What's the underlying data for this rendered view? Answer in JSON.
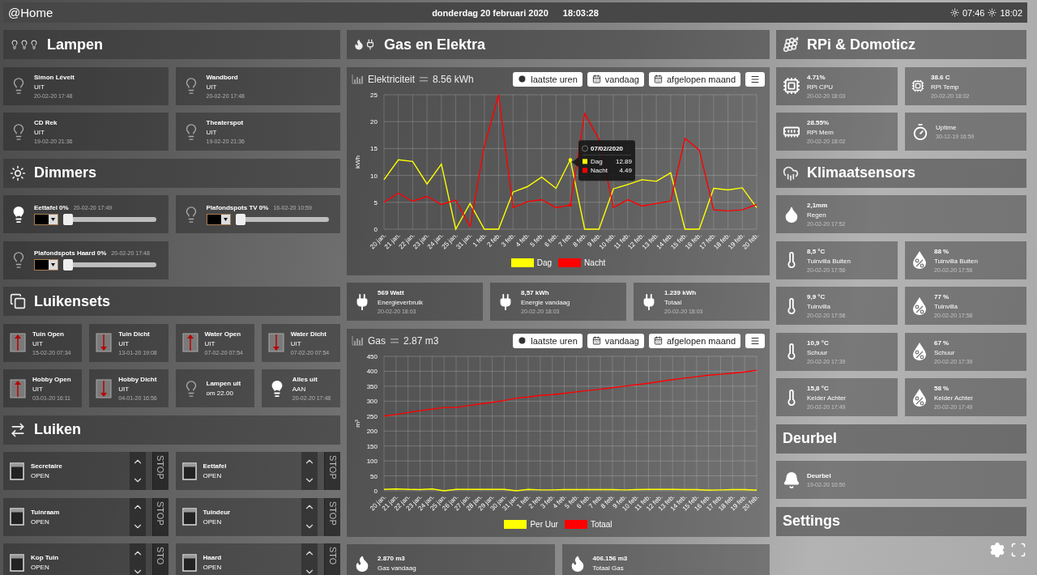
{
  "topbar": {
    "title": "@Home",
    "date": "donderdag 20 februari 2020",
    "time": "18:03:28",
    "sunrise": "07:46",
    "sunset": "18:02"
  },
  "columns": [
    [
      {
        "kind": "lamps",
        "title": "Lampen",
        "items": [
          {
            "kind": "lamp",
            "on": false,
            "title": "Simon Lévelt",
            "status": "UIT",
            "date": "20-02-20 17:48"
          },
          {
            "kind": "lamp",
            "on": false,
            "title": "Wandbord",
            "status": "UIT",
            "date": "20-02-20 17:48"
          },
          {
            "kind": "lamp",
            "on": false,
            "title": "CD Rek",
            "status": "UIT",
            "date": "19-02-20 21:36"
          },
          {
            "kind": "lamp",
            "on": false,
            "title": "Theaterspot",
            "status": "UIT",
            "date": "19-02-20 21:36"
          }
        ]
      },
      {
        "kind": "dimmers",
        "title": "Dimmers",
        "items": [
          {
            "kind": "dimmer",
            "on": true,
            "title": "Eettafel 0%",
            "date": "20-02-20 17:49",
            "color": "#000000",
            "level": 0
          },
          {
            "kind": "dimmer",
            "on": false,
            "title": "Plafondspots TV 0%",
            "date": "16-02-20 10:59",
            "color": "#000000",
            "level": 0
          },
          {
            "kind": "dimmer",
            "on": false,
            "title": "Plafondspots Haard 0%",
            "date": "20-02-20 17:48",
            "color": "#000000",
            "level": 0
          }
        ]
      },
      {
        "kind": "scenes",
        "title": "Luikensets",
        "items": [
          {
            "kind": "open",
            "title": "Tuin Open",
            "status": "UIT",
            "date": "15-02-20 07:34"
          },
          {
            "kind": "close",
            "title": "Tuin Dicht",
            "status": "UIT",
            "date": "13-01-20 19:08"
          },
          {
            "kind": "open",
            "title": "Water Open",
            "status": "UIT",
            "date": "07-02-20 07:54"
          },
          {
            "kind": "close",
            "title": "Water Dicht",
            "status": "UIT",
            "date": "07-02-20 07:54"
          },
          {
            "kind": "open",
            "title": "Hobby Open",
            "status": "UIT",
            "date": "03-01-20 16:11"
          },
          {
            "kind": "close",
            "title": "Hobby Dicht",
            "status": "UIT",
            "date": "04-01-20 16:56"
          },
          {
            "kind": "lamp",
            "on": false,
            "title": "Lampen uit",
            "status": "om 22.00"
          },
          {
            "kind": "lamp",
            "on": true,
            "title": "Alles uit",
            "status": "AAN",
            "date": "20-02-20 17:48"
          }
        ]
      },
      {
        "kind": "blinds",
        "title": "Luiken",
        "items": [
          {
            "kind": "blind",
            "title": "Secretaire",
            "status": "OPEN",
            "stop": "STOP"
          },
          {
            "kind": "blind",
            "title": "Eettafel",
            "status": "OPEN",
            "stop": "STOP"
          },
          {
            "kind": "blind",
            "title": "Tuinraam",
            "status": "OPEN",
            "stop": "STOP"
          },
          {
            "kind": "blind",
            "title": "Tuindeur",
            "status": "OPEN",
            "stop": "STOP"
          },
          {
            "kind": "blind",
            "title": "Kop Tuin",
            "status": "OPEN",
            "stop": "STO"
          },
          {
            "kind": "blind",
            "title": "Haard",
            "status": "OPEN",
            "stop": "STO"
          }
        ]
      }
    ],
    [
      {
        "kind": "energy",
        "title": "Gas en Elektra",
        "items": [
          {
            "kind": "chart",
            "title": "Elektriciteit",
            "reading": "8.56 kWh",
            "buttons": [
              "laatste uren",
              "vandaag",
              "afgelopen maand"
            ],
            "chart_data": {
              "type": "line",
              "ylabel": "kWh",
              "categories": [
                "20 jan.",
                "21 jan.",
                "22 jan.",
                "23 jan.",
                "24 jan.",
                "25 jan.",
                "31 jan.",
                "1 feb.",
                "2 feb.",
                "3 feb.",
                "4 feb.",
                "5 feb.",
                "6 feb.",
                "7 feb.",
                "8 feb.",
                "9 feb.",
                "10 feb.",
                "11 feb.",
                "12 feb.",
                "13 feb.",
                "14 feb.",
                "15 feb.",
                "16 feb.",
                "17 feb.",
                "18 feb.",
                "19 feb.",
                "20 feb."
              ],
              "yticks": [
                0,
                5,
                10,
                15,
                20,
                25
              ],
              "series": [
                {
                  "name": "Dag",
                  "color": "#ffff00",
                  "values": [
                    9.2,
                    12.9,
                    12.6,
                    8.4,
                    12.1,
                    0,
                    4.8,
                    0,
                    0,
                    6.9,
                    7.9,
                    9.7,
                    7.6,
                    12.9,
                    0,
                    0,
                    7.5,
                    8.3,
                    9.2,
                    8.9,
                    10.5,
                    0,
                    0,
                    7.6,
                    7.3,
                    7.7,
                    4.0
                  ]
                },
                {
                  "name": "Nacht",
                  "color": "#ff0000",
                  "values": [
                    5.0,
                    6.7,
                    5.2,
                    6.1,
                    4.6,
                    5.4,
                    0.5,
                    15.4,
                    25,
                    4.0,
                    5.1,
                    5.5,
                    4.0,
                    4.5,
                    21.5,
                    16.7,
                    4.0,
                    5.5,
                    4.3,
                    4.8,
                    5.2,
                    16.9,
                    14.7,
                    3.6,
                    3.4,
                    3.6,
                    4.6
                  ]
                }
              ],
              "ylim": [
                0,
                25
              ],
              "grid": true,
              "legend": "bottom"
            },
            "tooltip": {
              "x": "7 feb.",
              "date": "07/02/2020",
              "rows": [
                {
                  "label": "Dag",
                  "value": "12.89"
                },
                {
                  "label": "Nacht",
                  "value": "4.49"
                }
              ]
            }
          },
          {
            "kind": "stats",
            "items": [
              {
                "kind": "power",
                "title": "569 Watt",
                "status": "Energieverbruik",
                "date": "20-02-20 18:03"
              },
              {
                "kind": "power",
                "title": "8,57 kWh",
                "status": "Energie vandaag",
                "date": "20-02-20 18:03"
              },
              {
                "kind": "power",
                "title": "1.239 kWh",
                "status": "Totaal",
                "date": "20-02-20 18:03"
              }
            ]
          },
          {
            "kind": "chart",
            "title": "Gas",
            "reading": "2.87 m3",
            "buttons": [
              "laatste uren",
              "vandaag",
              "afgelopen maand"
            ],
            "chart_data": {
              "type": "line",
              "ylabel": "m³",
              "categories": [
                "20 jan.",
                "21 jan.",
                "22 jan.",
                "23 jan.",
                "24 jan.",
                "25 jan.",
                "26 jan.",
                "27 jan.",
                "28 jan.",
                "29 jan.",
                "30 jan.",
                "31 jan.",
                "1 feb.",
                "2 feb.",
                "3 feb.",
                "4 feb.",
                "5 feb.",
                "6 feb.",
                "7 feb.",
                "8 feb.",
                "9 feb.",
                "10 feb.",
                "11 feb.",
                "12 feb.",
                "13 feb.",
                "14 feb.",
                "15 feb.",
                "16 feb.",
                "17 feb.",
                "18 feb.",
                "19 feb.",
                "20 feb."
              ],
              "yticks": [
                0,
                50,
                100,
                150,
                200,
                250,
                300,
                350,
                400,
                450
              ],
              "ylim": [
                0,
                450
              ],
              "grid": true,
              "legend": "bottom",
              "series": [
                {
                  "name": "Per Uur",
                  "color": "#ffff00",
                  "values": [
                    5,
                    6,
                    5,
                    4,
                    6,
                    0,
                    5,
                    5,
                    5,
                    5,
                    5,
                    0,
                    5,
                    3,
                    3,
                    4,
                    4,
                    4,
                    4,
                    4,
                    3,
                    4,
                    5,
                    5,
                    5,
                    4,
                    4,
                    2,
                    3,
                    4,
                    4,
                    2
                  ]
                },
                {
                  "name": "Totaal",
                  "color": "#ff0000",
                  "values": [
                    250,
                    255,
                    262,
                    268,
                    273,
                    279,
                    279,
                    285,
                    291,
                    296,
                    302,
                    310,
                    314,
                    319,
                    322,
                    326,
                    331,
                    336,
                    340,
                    345,
                    350,
                    355,
                    360,
                    366,
                    372,
                    377,
                    382,
                    387,
                    390,
                    394,
                    398,
                    403
                  ]
                }
              ]
            }
          },
          {
            "kind": "stats",
            "items": [
              {
                "kind": "gas",
                "title": "2.870 m3",
                "status": "Gas vandaag"
              },
              {
                "kind": "gas",
                "title": "406.156 m3",
                "status": "Totaal Gas"
              }
            ]
          }
        ]
      }
    ],
    [
      {
        "kind": "system",
        "title": "RPi & Domoticz",
        "items": [
          {
            "kind": "cpu",
            "title": "4.71%",
            "status": "RPi CPU",
            "date": "20-02-20 18:03"
          },
          {
            "kind": "chiptemp",
            "title": "38.6 C",
            "status": "RPi Temp",
            "date": "20-02-20 18:02"
          },
          {
            "kind": "memory",
            "title": "28.55%",
            "status": "RPi Mem",
            "date": "20-02-20 18:02"
          },
          {
            "kind": "uptime",
            "status": "Uptime",
            "date": "30-12-19 16:59"
          }
        ]
      },
      {
        "kind": "climate",
        "title": "Klimaatsensors",
        "items": [
          {
            "kind": "rain",
            "title": "2,1mm",
            "status": "Regen",
            "date": "20-02-20 17:52"
          },
          {
            "kind": "temperature",
            "title": "8,5 °C",
            "status": "Tuinvilla Buiten",
            "date": "20-02-20 17:56"
          },
          {
            "kind": "humidity",
            "title": "88 %",
            "status": "Tuinvilla Buiten",
            "date": "20-02-20 17:56"
          },
          {
            "kind": "temperature",
            "title": "9,9 °C",
            "status": "Tuinvilla",
            "date": "20-02-20 17:58"
          },
          {
            "kind": "humidity",
            "title": "77 %",
            "status": "Tuinvilla",
            "date": "20-02-20 17:58"
          },
          {
            "kind": "temperature",
            "title": "10,9 °C",
            "status": "Schuur",
            "date": "20-02-20 17:39"
          },
          {
            "kind": "humidity",
            "title": "67 %",
            "status": "Schuur",
            "date": "20-02-20 17:39"
          },
          {
            "kind": "temperature",
            "title": "15,8 °C",
            "status": "Kelder Achter",
            "date": "20-02-20 17:49"
          },
          {
            "kind": "humidity",
            "title": "58 %",
            "status": "Kelder Achter",
            "date": "20-02-20 17:49"
          }
        ]
      },
      {
        "kind": "plain",
        "title": "Deurbel",
        "items": [
          {
            "kind": "bell",
            "title": "Deurbel",
            "date": "19-02-20 10:50"
          }
        ]
      },
      {
        "kind": "plain",
        "title": "Settings"
      }
    ]
  ]
}
